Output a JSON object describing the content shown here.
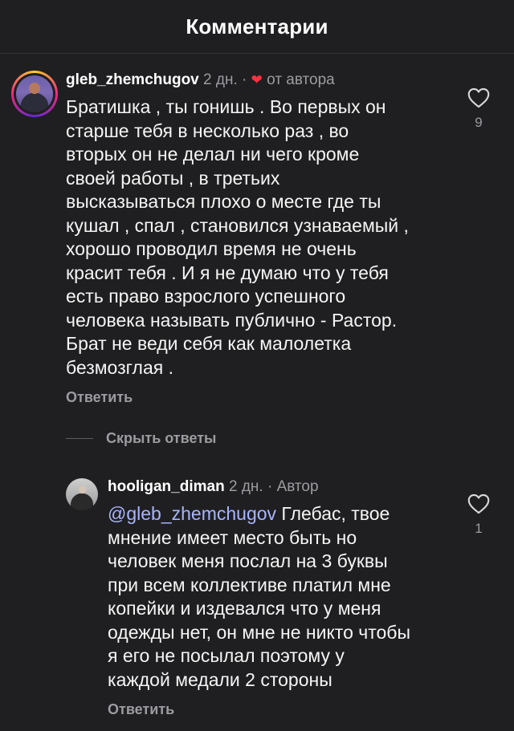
{
  "header": {
    "title": "Комментарии"
  },
  "comments": [
    {
      "username": "gleb_zhemchugov",
      "time": "2 дн.",
      "separator": "·",
      "by_author_label": "от автора",
      "text_lines": [
        "Братишка , ты гонишь . Во первых он",
        "старше тебя в несколько раз , во",
        "вторых он не делал ни чего кроме",
        "своей работы , в третьих",
        "высказываться плохо о месте где ты",
        "кушал , спал , становился узнаваемый ,",
        "хорошо проводил время не очень",
        "красит тебя . И я не думаю что у тебя",
        "есть право взрослого успешного",
        "человека называть публично - Растор.",
        "Брат не веди себя как малолетка",
        "безмозглая ."
      ],
      "reply_label": "Ответить",
      "likes": "9"
    }
  ],
  "hide_replies_label": "Скрыть ответы",
  "reply": {
    "username": "hooligan_diman",
    "time": "2 дн.",
    "separator": "·",
    "author_badge": "Автор",
    "mention": "@gleb_zhemchugov",
    "text_lines": [
      "Глебас, твое",
      "мнение имеет место быть но",
      "человек меня послал на 3 буквы",
      "при всем коллективе платил мне",
      "копейки и издевался что у меня",
      "одежды нет, он мне не никто чтобы",
      "я его не посылал поэтому у",
      "каждой медали 2 стороны"
    ],
    "reply_label": "Ответить",
    "likes": "1"
  },
  "icons": {
    "heart_outline": "heart-outline-icon",
    "heart_filled": "heart-filled-icon",
    "accent_red": "#ff3040",
    "meta_gray": "#9b9ba1",
    "mention_blue": "#a8b4ff"
  }
}
